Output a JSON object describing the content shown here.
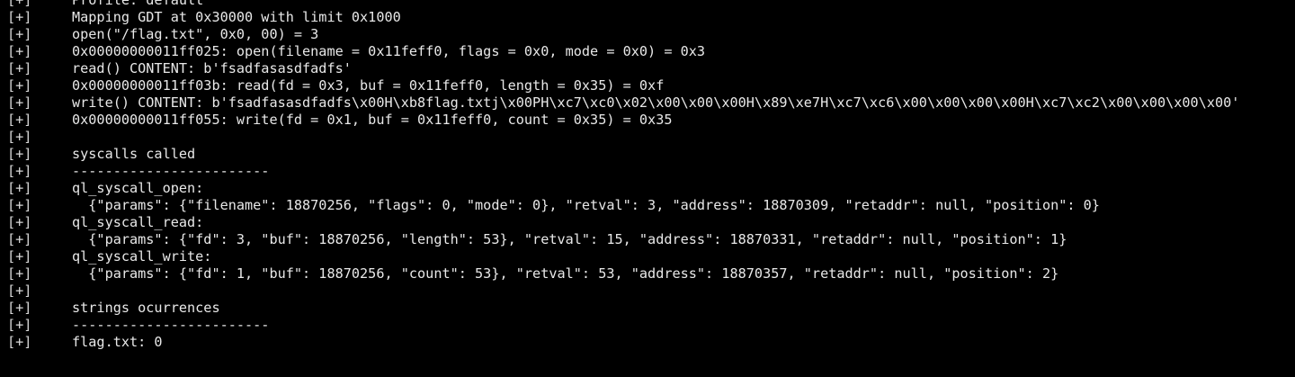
{
  "terminal": {
    "lines": [
      {
        "prefix": "[+]",
        "text": "Profile: default"
      },
      {
        "prefix": "[+]",
        "text": "Mapping GDT at 0x30000 with limit 0x1000"
      },
      {
        "prefix": "[+]",
        "text": "open(\"/flag.txt\", 0x0, 00) = 3"
      },
      {
        "prefix": "[+]",
        "text": "0x00000000011ff025: open(filename = 0x11feff0, flags = 0x0, mode = 0x0) = 0x3"
      },
      {
        "prefix": "[+]",
        "text": "read() CONTENT: b'fsadfasasdfadfs'"
      },
      {
        "prefix": "[+]",
        "text": "0x00000000011ff03b: read(fd = 0x3, buf = 0x11feff0, length = 0x35) = 0xf"
      },
      {
        "prefix": "[+]",
        "text": "write() CONTENT: b'fsadfasasdfadfs\\x00H\\xb8flag.txtj\\x00PH\\xc7\\xc0\\x02\\x00\\x00\\x00H\\x89\\xe7H\\xc7\\xc6\\x00\\x00\\x00\\x00H\\xc7\\xc2\\x00\\x00\\x00\\x00'"
      },
      {
        "prefix": "[+]",
        "text": "0x00000000011ff055: write(fd = 0x1, buf = 0x11feff0, count = 0x35) = 0x35"
      },
      {
        "prefix": "[+]",
        "text": ""
      },
      {
        "prefix": "[+]",
        "text": "syscalls called"
      },
      {
        "prefix": "[+]",
        "text": "------------------------"
      },
      {
        "prefix": "[+]",
        "text": "ql_syscall_open:"
      },
      {
        "prefix": "[+]",
        "text": "  {\"params\": {\"filename\": 18870256, \"flags\": 0, \"mode\": 0}, \"retval\": 3, \"address\": 18870309, \"retaddr\": null, \"position\": 0}"
      },
      {
        "prefix": "[+]",
        "text": "ql_syscall_read:"
      },
      {
        "prefix": "[+]",
        "text": "  {\"params\": {\"fd\": 3, \"buf\": 18870256, \"length\": 53}, \"retval\": 15, \"address\": 18870331, \"retaddr\": null, \"position\": 1}"
      },
      {
        "prefix": "[+]",
        "text": "ql_syscall_write:"
      },
      {
        "prefix": "[+]",
        "text": "  {\"params\": {\"fd\": 1, \"buf\": 18870256, \"count\": 53}, \"retval\": 53, \"address\": 18870357, \"retaddr\": null, \"position\": 2}"
      },
      {
        "prefix": "[+]",
        "text": ""
      },
      {
        "prefix": "[+]",
        "text": "strings ocurrences"
      },
      {
        "prefix": "[+]",
        "text": "------------------------"
      },
      {
        "prefix": "[+]",
        "text": "flag.txt: 0"
      }
    ]
  }
}
